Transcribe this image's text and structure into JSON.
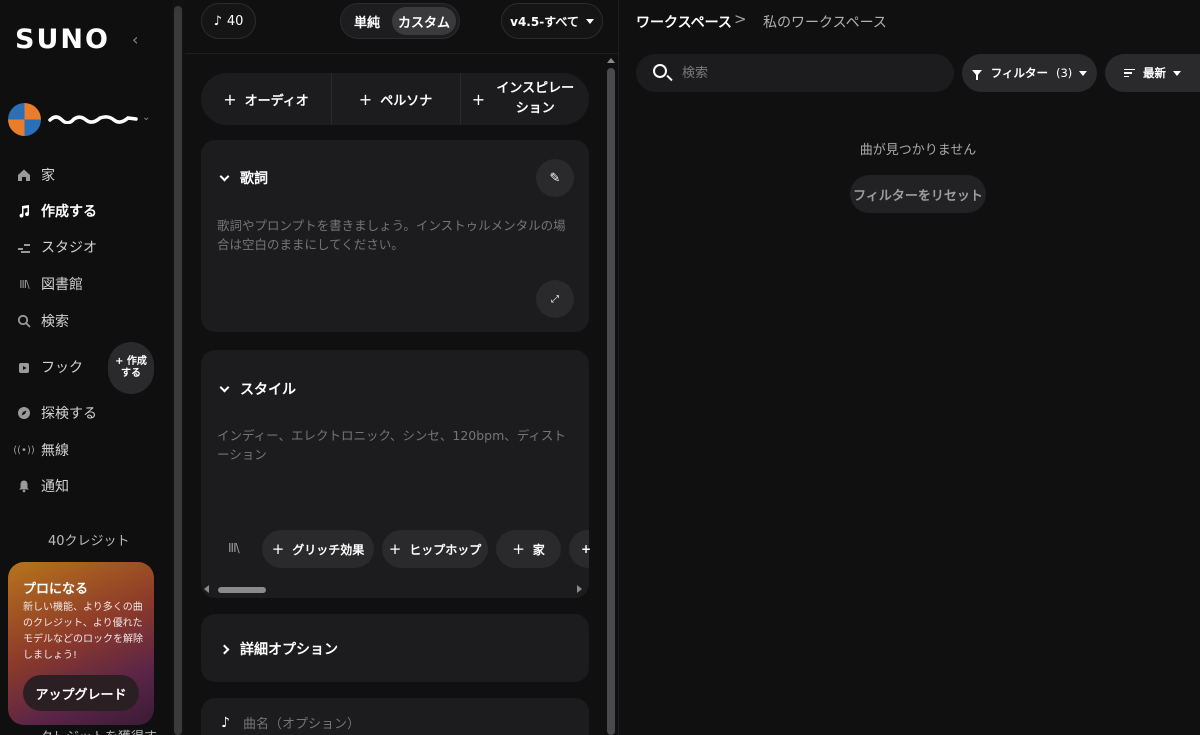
{
  "sidebar": {
    "logo": "SUNO",
    "nav": [
      {
        "label": "家",
        "icon": "home-icon"
      },
      {
        "label": "作成する",
        "icon": "music-note-icon",
        "active": true
      },
      {
        "label": "スタジオ",
        "icon": "studio-icon"
      },
      {
        "label": "図書館",
        "icon": "library-icon"
      },
      {
        "label": "検索",
        "icon": "search-icon"
      },
      {
        "label": "フック",
        "icon": "hook-icon"
      },
      {
        "label": "探検する",
        "icon": "compass-icon"
      },
      {
        "label": "無線",
        "icon": "radio-icon"
      },
      {
        "label": "通知",
        "icon": "bell-icon"
      }
    ],
    "hook_create_label": "+ 作成する",
    "credits_label": "40クレジット",
    "promo": {
      "title": "プロになる",
      "body": "新しい機能、より多くの曲のクレジット、より優れたモデルなどのロックを解除しましょう!",
      "upgrade_label": "アップグレード"
    },
    "earn_label": "クレジットを獲得す"
  },
  "composer": {
    "credit_count": "40",
    "mode_simple": "単純",
    "mode_custom": "カスタム",
    "version_label": "v4.5-すべて",
    "add_buttons": [
      "オーディオ",
      "ペルソナ",
      "インスピレーション"
    ],
    "lyrics": {
      "title": "歌詞",
      "placeholder": "歌詞やプロンプトを書きましょう。インストゥルメンタルの場合は空白のままにしてください。"
    },
    "style": {
      "title": "スタイル",
      "placeholder": "インディー、エレクトロニック、シンセ、120bpm、ディストーション",
      "chips": [
        "グリッチ効果",
        "ヒップホップ",
        "家"
      ]
    },
    "advanced_label": "詳細オプション",
    "song_title_placeholder": "曲名（オプション）"
  },
  "workspace": {
    "breadcrumb_root": "ワークスペース",
    "breadcrumb_separator": ">",
    "breadcrumb_current": "私のワークスペース",
    "search_placeholder": "検索",
    "filter_label": "フィルター",
    "filter_count": "(3)",
    "sort_label": "最新",
    "empty_message": "曲が見つかりません",
    "reset_label": "フィルターをリセット"
  },
  "colors": {
    "background": "#0f0f10",
    "card": "#1c1c1e",
    "pill": "#2a2a2c",
    "promo_start": "#b8741b",
    "promo_end": "#3a1a36"
  }
}
